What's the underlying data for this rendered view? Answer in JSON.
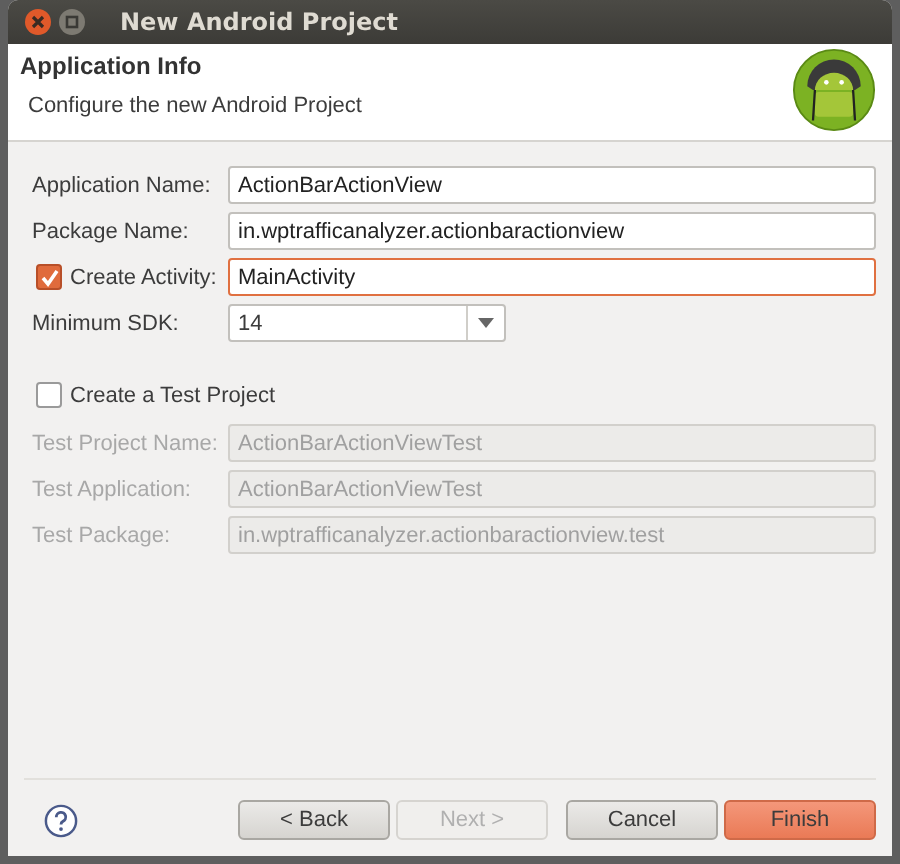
{
  "window": {
    "title": "New Android Project"
  },
  "header": {
    "title": "Application Info",
    "subtitle": "Configure the new Android Project"
  },
  "fields": [
    {
      "kind": "text",
      "label": "Application Name:",
      "value": "ActionBarActionView",
      "focused": false
    },
    {
      "kind": "text",
      "label": "Package Name:",
      "value": "in.wptrafficanalyzer.actionbaractionview",
      "focused": false
    },
    {
      "kind": "checkbox",
      "label": "Create Activity:",
      "checked": true,
      "value": "MainActivity",
      "focused": true
    },
    {
      "kind": "dropdown",
      "label": "Minimum SDK:",
      "value": "14",
      "focused": false
    }
  ],
  "test_project": {
    "label": "Create a Test Project",
    "checked": false
  },
  "test_fields": [
    {
      "label": "Test Project Name:",
      "value": "ActionBarActionViewTest",
      "disabled": true
    },
    {
      "label": "Test Application:",
      "value": "ActionBarActionViewTest",
      "disabled": true
    },
    {
      "label": "Test Package:",
      "value": "in.wptrafficanalyzer.actionbaractionview.test",
      "disabled": true
    }
  ],
  "buttons": [
    {
      "label": "< Back",
      "disabled": false,
      "default": false
    },
    {
      "label": "Next >",
      "disabled": true,
      "default": false
    },
    {
      "label": "Cancel",
      "disabled": false,
      "default": false
    },
    {
      "label": "Finish",
      "disabled": false,
      "default": true
    }
  ]
}
